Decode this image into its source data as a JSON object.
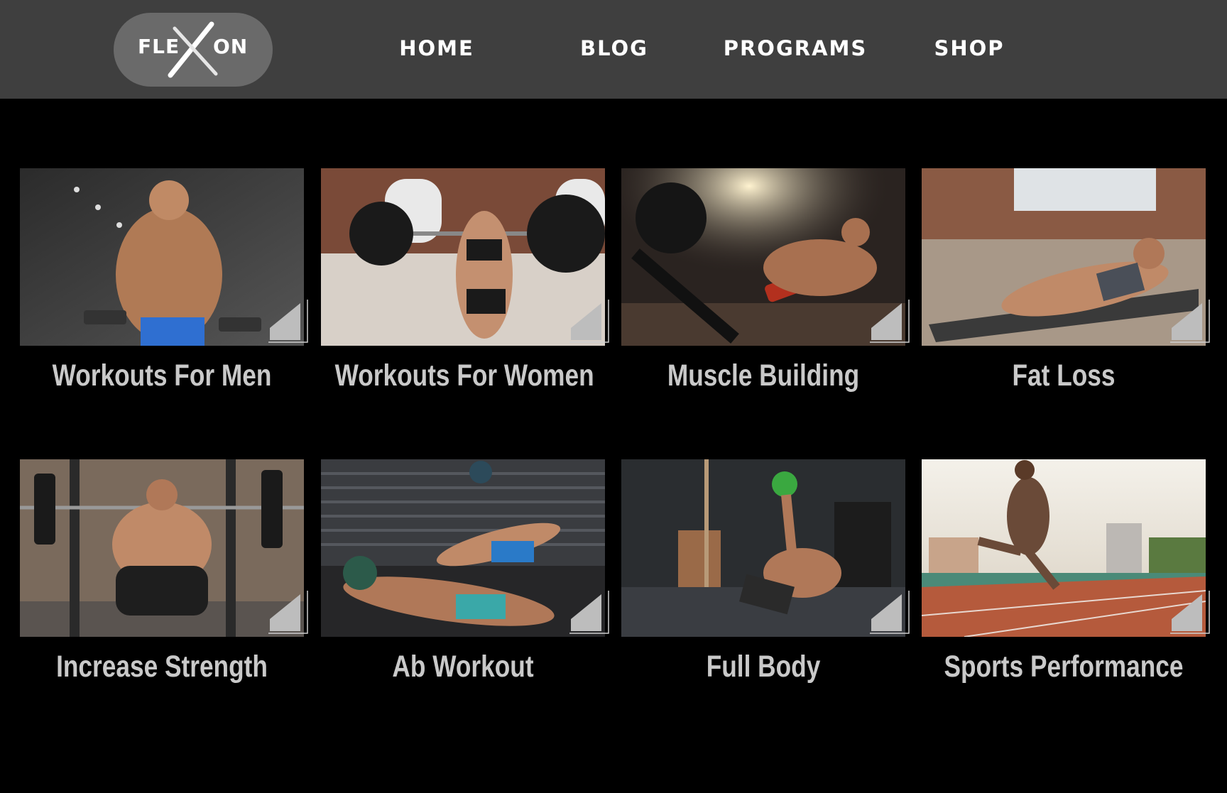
{
  "logo": {
    "left_text": "FLE",
    "right_text": "ON"
  },
  "nav": {
    "home": "HOME",
    "blog": "BLOG",
    "programs": "PROGRAMS",
    "shop": "SHOP"
  },
  "cards": [
    {
      "title": "Workouts For Men"
    },
    {
      "title": "Workouts For Women"
    },
    {
      "title": "Muscle Building"
    },
    {
      "title": "Fat Loss"
    },
    {
      "title": "Increase Strength"
    },
    {
      "title": "Ab Workout"
    },
    {
      "title": "Full Body"
    },
    {
      "title": "Sports Performance"
    }
  ],
  "colors": {
    "header_bg": "#3f3f3f",
    "logo_pill": "#6a6a6a",
    "page_bg": "#000000",
    "title_text": "#c9c9c9",
    "corner_fold": "#bdbdbd"
  }
}
